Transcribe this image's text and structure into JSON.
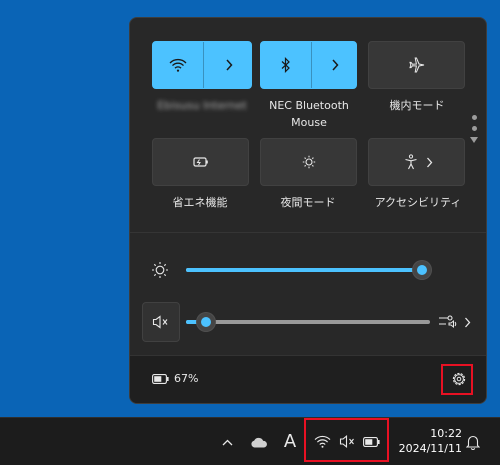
{
  "quick_settings": {
    "tiles": [
      {
        "id": "wifi",
        "label": "Ebisusu Internet",
        "state": "on",
        "icon": "wifi-icon",
        "has_chevron": true
      },
      {
        "id": "bluetooth",
        "label": "NEC Bluetooth Mouse",
        "state": "on",
        "icon": "bluetooth-icon",
        "has_chevron": true
      },
      {
        "id": "airplane",
        "label": "機内モード",
        "state": "off",
        "icon": "airplane-icon",
        "has_chevron": false
      },
      {
        "id": "battery-saver",
        "label": "省エネ機能",
        "state": "off",
        "icon": "battery-saver-icon",
        "has_chevron": false
      },
      {
        "id": "night-light",
        "label": "夜間モード",
        "state": "off",
        "icon": "night-light-icon",
        "has_chevron": false
      },
      {
        "id": "accessibility",
        "label": "アクセシビリティ",
        "state": "off",
        "icon": "accessibility-icon",
        "has_chevron": true
      }
    ],
    "brightness": {
      "icon": "brightness-icon",
      "level": 1.0
    },
    "volume": {
      "icon": "speaker-muted-icon",
      "level": 0.08,
      "muted": true
    },
    "audio_output_icon": "audio-output-icon",
    "battery": {
      "percent_text": "67%",
      "icon": "battery-icon",
      "level": 0.67
    },
    "settings_icon": "gear-icon"
  },
  "taskbar": {
    "ime_indicator": "A",
    "time": "10:22",
    "date": "2024/11/11",
    "icons": [
      "chevron-up-icon",
      "onedrive-cloud-icon",
      "wifi-icon",
      "speaker-muted-icon",
      "battery-icon",
      "bell-icon"
    ]
  },
  "colors": {
    "accent": "#4cc2ff",
    "highlight": "#e81123",
    "desktop": "#0a64b6",
    "panel": "#282828"
  }
}
